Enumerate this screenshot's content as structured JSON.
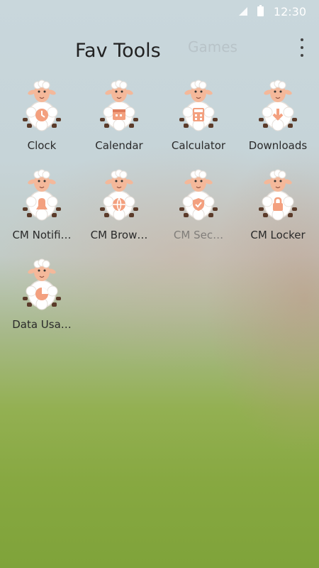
{
  "status_bar": {
    "time": "12:30"
  },
  "header": {
    "tabs": [
      {
        "label": "Fav Tools",
        "active": true
      },
      {
        "label": "Games",
        "active": false
      }
    ]
  },
  "apps": [
    {
      "label": "Clock",
      "icon": "clock-icon"
    },
    {
      "label": "Calendar",
      "icon": "calendar-icon"
    },
    {
      "label": "Calculator",
      "icon": "calculator-icon"
    },
    {
      "label": "Downloads",
      "icon": "downloads-icon"
    },
    {
      "label": "CM Notifi…",
      "icon": "notification-icon"
    },
    {
      "label": "CM Brow…",
      "icon": "browser-icon"
    },
    {
      "label": "CM Sec…",
      "icon": "security-icon"
    },
    {
      "label": "CM Locker",
      "icon": "lock-icon"
    },
    {
      "label": "Data Usa…",
      "icon": "pie-icon"
    }
  ],
  "colors": {
    "sheep_face": "#f4b89a",
    "sheep_body": "#ffffff",
    "accent": "#f3a07f"
  }
}
